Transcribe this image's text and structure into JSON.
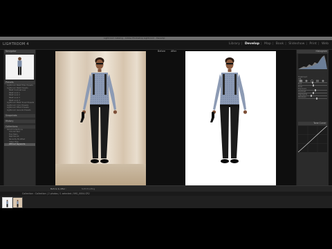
{
  "app": {
    "title": "LIGHTROOM 4",
    "window_title": "Lightroom Catalog - Adobe Photoshop Lightroom - Develop"
  },
  "modules": [
    "Library",
    "Develop",
    "Map",
    "Book",
    "Slideshow",
    "Print",
    "Web"
  ],
  "active_module": "Develop",
  "left_panel": {
    "navigator": "Navigator",
    "presets": "Presets",
    "preset_items": [
      "Lightroom B&W Filter Presets",
      "Lightroom B&W Presets",
      "B&W Contrast Low",
      "B&W Look 1",
      "B&W Look 2",
      "B&W Look 3",
      "B&W Look 4",
      "Lightroom B&W Toned Presets",
      "Lightroom Color Presets",
      "Lightroom Effect Presets",
      "Lightroom General Presets"
    ],
    "snapshots": "Snapshots",
    "history": "History",
    "collections": "Collections",
    "collection_items": [
      "Smart Collections",
      "Colored Red",
      "Five Stars",
      "Past Month",
      "Recently Modified",
      "Video Files",
      "Without Keywords"
    ],
    "copy_button": "Copy...",
    "paste_button": "Paste"
  },
  "center": {
    "before_label": "Before",
    "after_label": "After"
  },
  "toolbar": {
    "view_label": "Before & After :",
    "soft_proof": "Soft Proofing"
  },
  "right_panel": {
    "histogram": "Histogram",
    "basic_rows": [
      "Treatment",
      "WB",
      "Temp",
      "Tint",
      "Tone",
      "Exposure",
      "Contrast",
      "Highlights",
      "Shadows",
      "Whites",
      "Blacks",
      "Presence",
      "Clarity",
      "Vibrance",
      "Saturation"
    ],
    "tone_curve": "Tone Curve",
    "previous_button": "Previous",
    "reset_button": "Reset"
  },
  "filmstrip": {
    "path": "Collection : Collection  |  2 photos / 1 selected / IMG_0004.CR2"
  },
  "colors": {
    "accent": "#eeeeee",
    "panel": "#2b2b2b",
    "backdrop_before": "#e5dac8",
    "backdrop_after": "#ffffff"
  }
}
